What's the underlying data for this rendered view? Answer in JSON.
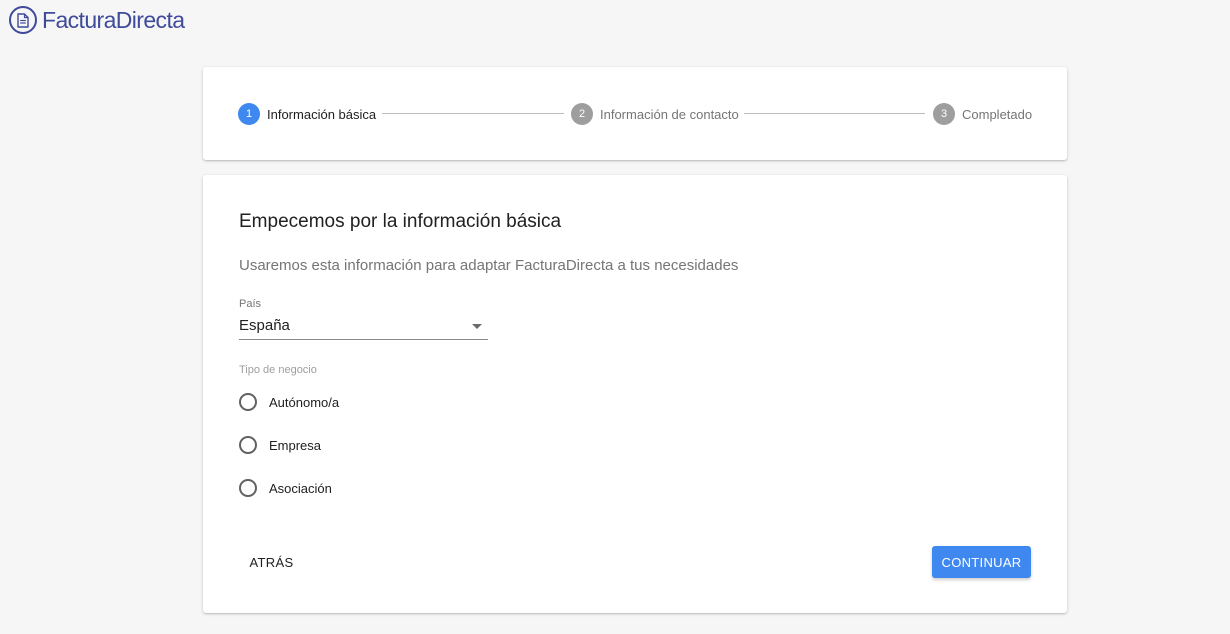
{
  "brand": {
    "name": "FacturaDirecta",
    "logo_icon": "document-icon",
    "color": "#3f4a9a"
  },
  "stepper": {
    "steps": [
      {
        "number": "1",
        "label": "Información básica",
        "active": true
      },
      {
        "number": "2",
        "label": "Información de contacto",
        "active": false
      },
      {
        "number": "3",
        "label": "Completado",
        "active": false
      }
    ]
  },
  "form": {
    "title": "Empecemos por la información básica",
    "subtitle": "Usaremos esta información para adaptar FacturaDirecta a tus necesidades",
    "country": {
      "label": "País",
      "value": "España"
    },
    "business_type": {
      "label": "Tipo de negocio",
      "options": [
        "Autónomo/a",
        "Empresa",
        "Asociación"
      ],
      "selected": null
    },
    "back_label": "ATRÁS",
    "continue_label": "CONTINUAR"
  },
  "colors": {
    "accent": "#3f88f0",
    "inactive_step": "#9e9e9e",
    "background": "#f6f6f6"
  }
}
